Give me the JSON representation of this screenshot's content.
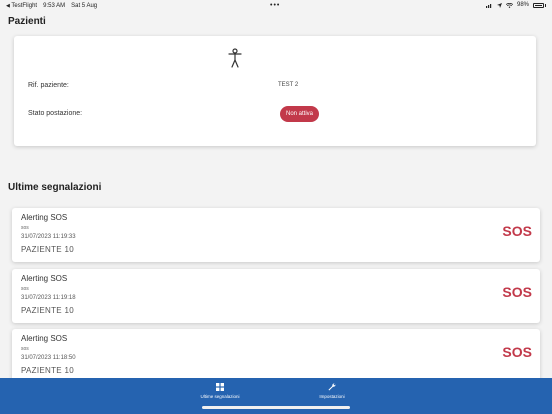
{
  "status_bar": {
    "back_app": "TestFlight",
    "time": "9:53 AM",
    "date": "Sat 5 Aug",
    "battery": "98%"
  },
  "patients": {
    "title": "Pazienti",
    "patient_ref_label": "Rif. paziente:",
    "patient_ref_value": "TEST 2",
    "station_status_label": "Stato postazione:",
    "station_status_value": "Non attiva",
    "person_icon": "accessibility-person-icon"
  },
  "alerts": {
    "title": "Ultime segnalazioni",
    "items": [
      {
        "title": "Alerting SOS",
        "sub": "sos",
        "time": "31/07/2023 11:19:33",
        "patient": "PAZIENTE 10",
        "badge": "SOS"
      },
      {
        "title": "Alerting SOS",
        "sub": "sos",
        "time": "31/07/2023 11:19:18",
        "patient": "PAZIENTE 10",
        "badge": "SOS"
      },
      {
        "title": "Alerting SOS",
        "sub": "sos",
        "time": "31/07/2023 11:18:50",
        "patient": "PAZIENTE 10",
        "badge": "SOS"
      }
    ]
  },
  "bottom_nav": {
    "items": [
      {
        "label": "Ultime segnalazioni",
        "icon": "grid-icon"
      },
      {
        "label": "Impostazioni",
        "icon": "wrench-icon"
      }
    ]
  },
  "colors": {
    "accent_red": "#c2394a",
    "nav_blue": "#2563b0",
    "background": "#f3f3f3"
  }
}
